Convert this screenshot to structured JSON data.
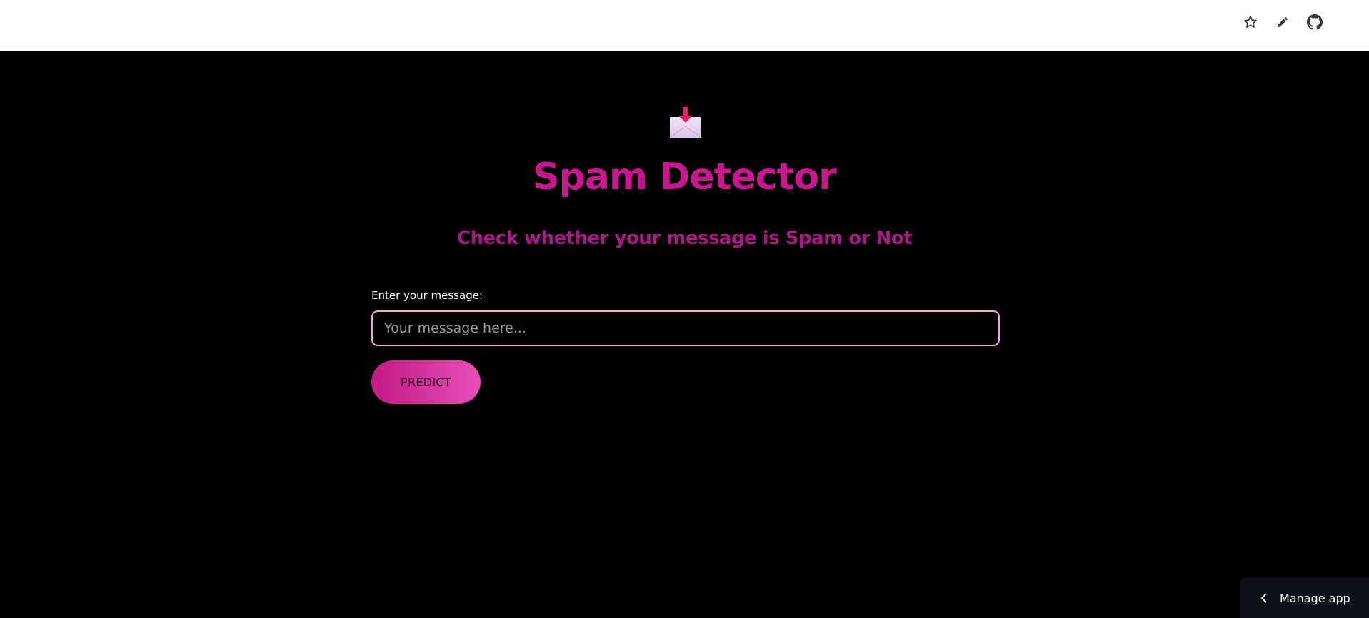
{
  "toolbar": {
    "icons": [
      "star-icon",
      "edit-pencil-icon",
      "github-icon"
    ]
  },
  "hero": {
    "icon": "inbox-tray-icon",
    "title": "Spam Detector",
    "subtitle": "Check whether your message is Spam or Not"
  },
  "form": {
    "label": "Enter your message:",
    "input_value": "",
    "input_placeholder": "Your message here...",
    "button_label": "PREDICT"
  },
  "manage_app": {
    "label": "Manage app",
    "icon": "chevron-left-icon"
  },
  "colors": {
    "accent": "#c9178f",
    "subtitle": "#a91a86",
    "input_border": "#f2a7d8",
    "button_gradient_start": "#c31a86",
    "button_gradient_end": "#e64fb8",
    "background": "#000000"
  }
}
